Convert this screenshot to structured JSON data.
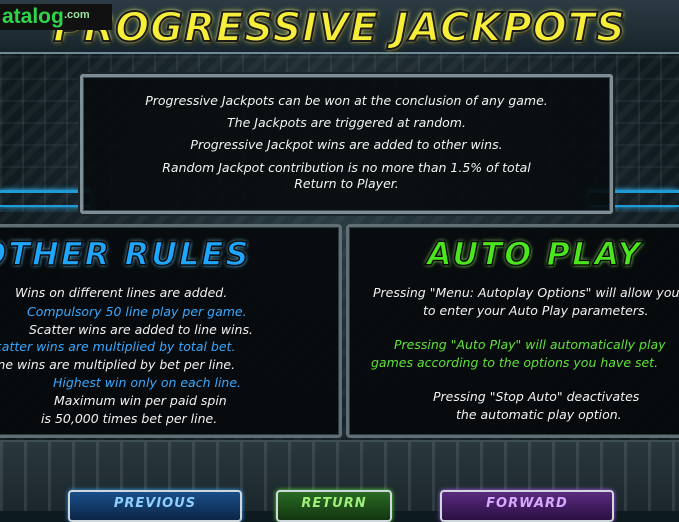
{
  "header": {
    "title": "PROGRESSIVE JACKPOTS",
    "watermark": "atalog",
    "watermark_suffix": ".com"
  },
  "jackpot_info": {
    "lines": [
      "Progressive Jackpots can be won at the conclusion of any game.",
      "The Jackpots are triggered at random.",
      "Progressive Jackpot wins are added to other wins.",
      "Random Jackpot contribution is no more than 1.5% of total",
      "Return to Player."
    ]
  },
  "other_rules": {
    "heading": "OTHER RULES",
    "lines": [
      {
        "text": "Wins on different lines are added.",
        "color": "#f2f2f2"
      },
      {
        "text": "Compulsory 50 line play per game.",
        "color": "#39a8ff"
      },
      {
        "text": "Scatter wins are added to line wins.",
        "color": "#f2f2f2"
      },
      {
        "text": "Scatter wins are multiplied by total bet.",
        "color": "#39a8ff"
      },
      {
        "text": "Line wins are multiplied by bet per line.",
        "color": "#f2f2f2"
      },
      {
        "text": "Highest win only on each line.",
        "color": "#39a8ff"
      },
      {
        "text": "Maximum win per paid spin",
        "color": "#f2f2f2"
      },
      {
        "text": "is 50,000 times bet per line.",
        "color": "#f2f2f2"
      }
    ]
  },
  "auto_play": {
    "heading": "AUTO PLAY",
    "lines": [
      {
        "text": "Pressing \"Menu: Autoplay Options\" will allow you",
        "color": "#f2f2f2"
      },
      {
        "text": "to enter your Auto Play parameters.",
        "color": "#f2f2f2"
      },
      {
        "text": "Pressing \"Auto Play\" will automatically play",
        "color": "#5fe23b"
      },
      {
        "text": "games according to the options you have set.",
        "color": "#5fe23b"
      },
      {
        "text": "Pressing \"Stop Auto\" deactivates",
        "color": "#f2f2f2"
      },
      {
        "text": "the automatic play option.",
        "color": "#f2f2f2"
      }
    ]
  },
  "nav": {
    "previous": "PREVIOUS",
    "return": "RETURN",
    "forward": "FORWARD"
  },
  "colors": {
    "title_yellow": "#f7ee3a",
    "heading_blue": "#1fa7ff",
    "heading_green": "#4be61e"
  }
}
